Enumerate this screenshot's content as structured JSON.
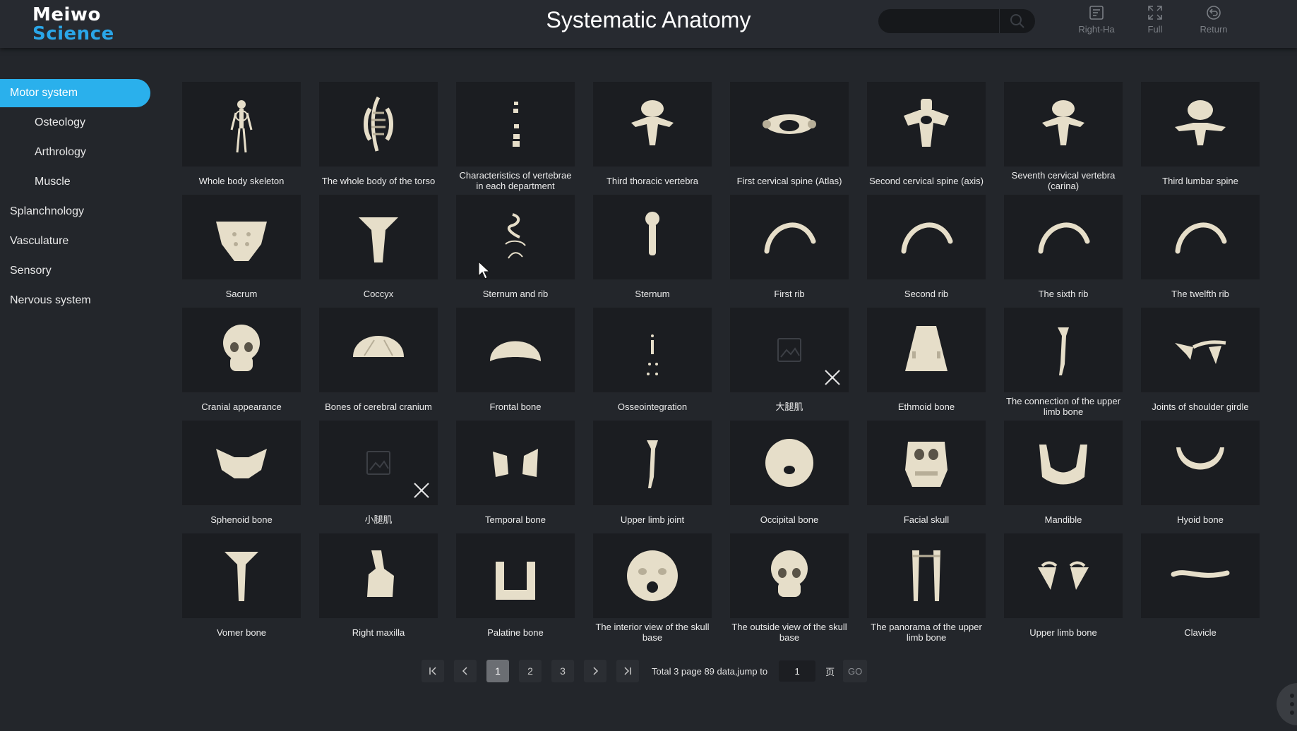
{
  "header": {
    "logo_line1": "Meiwo",
    "logo_line2": "Science",
    "title": "Systematic Anatomy",
    "search_placeholder": "",
    "tools": [
      {
        "label": "Right-Ha",
        "icon": "hand-sliders-icon"
      },
      {
        "label": "Full",
        "icon": "fullscreen-icon"
      },
      {
        "label": "Return",
        "icon": "return-icon"
      }
    ]
  },
  "sidebar": {
    "items": [
      {
        "label": "Motor system",
        "active": true,
        "level": 1
      },
      {
        "label": "Osteology",
        "active": false,
        "level": 2
      },
      {
        "label": "Arthrology",
        "active": false,
        "level": 2
      },
      {
        "label": "Muscle",
        "active": false,
        "level": 2
      },
      {
        "label": "Splanchnology",
        "active": false,
        "level": 1
      },
      {
        "label": "Vasculature",
        "active": false,
        "level": 1
      },
      {
        "label": "Sensory",
        "active": false,
        "level": 1
      },
      {
        "label": "Nervous system",
        "active": false,
        "level": 1
      }
    ]
  },
  "grid": {
    "items": [
      {
        "label": "Whole body skeleton",
        "icon": "skeleton-icon"
      },
      {
        "label": "The whole body of the torso",
        "icon": "spine-torso-icon"
      },
      {
        "label": "Characteristics of vertebrae in each department",
        "icon": "vertebrae-column-icon"
      },
      {
        "label": "Third thoracic vertebra",
        "icon": "vertebra-icon"
      },
      {
        "label": "First cervical spine (Atlas)",
        "icon": "atlas-vertebra-icon"
      },
      {
        "label": "Second cervical spine (axis)",
        "icon": "axis-vertebra-icon"
      },
      {
        "label": "Seventh cervical vertebra (carina)",
        "icon": "vertebra-icon"
      },
      {
        "label": "Third lumbar spine",
        "icon": "lumbar-vertebra-icon"
      },
      {
        "label": "Sacrum",
        "icon": "sacrum-icon"
      },
      {
        "label": "Coccyx",
        "icon": "coccyx-icon"
      },
      {
        "label": "Sternum and rib",
        "icon": "sternum-rib-icon"
      },
      {
        "label": "Sternum",
        "icon": "sternum-icon"
      },
      {
        "label": "First rib",
        "icon": "rib-icon"
      },
      {
        "label": "Second rib",
        "icon": "rib-icon"
      },
      {
        "label": "The sixth rib",
        "icon": "rib-icon"
      },
      {
        "label": "The twelfth rib",
        "icon": "rib-icon"
      },
      {
        "label": "Cranial appearance",
        "icon": "skull-icon"
      },
      {
        "label": "Bones of cerebral cranium",
        "icon": "cranium-icon"
      },
      {
        "label": "Frontal bone",
        "icon": "frontal-bone-icon"
      },
      {
        "label": "Osseointegration",
        "icon": "osseointegration-icon"
      },
      {
        "label": "大腿肌",
        "icon": "placeholder-image-icon",
        "broken": true
      },
      {
        "label": "Ethmoid bone",
        "icon": "ethmoid-bone-icon"
      },
      {
        "label": "The connection of the upper limb bone",
        "icon": "arm-bone-icon"
      },
      {
        "label": "Joints of shoulder girdle",
        "icon": "shoulder-girdle-icon"
      },
      {
        "label": "Sphenoid bone",
        "icon": "sphenoid-bone-icon"
      },
      {
        "label": "小腿肌",
        "icon": "placeholder-image-icon",
        "broken": true
      },
      {
        "label": "Temporal bone",
        "icon": "temporal-bone-icon"
      },
      {
        "label": "Upper limb joint",
        "icon": "arm-bone-icon"
      },
      {
        "label": "Occipital bone",
        "icon": "occipital-bone-icon"
      },
      {
        "label": "Facial skull",
        "icon": "facial-skull-icon"
      },
      {
        "label": "Mandible",
        "icon": "mandible-icon"
      },
      {
        "label": "Hyoid bone",
        "icon": "hyoid-bone-icon"
      },
      {
        "label": "Vomer bone",
        "icon": "vomer-bone-icon"
      },
      {
        "label": "Right maxilla",
        "icon": "maxilla-icon"
      },
      {
        "label": "Palatine bone",
        "icon": "palatine-bone-icon"
      },
      {
        "label": "The interior view of the skull base",
        "icon": "skull-base-icon"
      },
      {
        "label": "The outside view of the skull base",
        "icon": "skull-icon"
      },
      {
        "label": "The panorama of the upper limb bone",
        "icon": "arm-bones-pair-icon"
      },
      {
        "label": "Upper limb bone",
        "icon": "scapula-pair-icon"
      },
      {
        "label": "Clavicle",
        "icon": "clavicle-icon"
      }
    ]
  },
  "pagination": {
    "pages": [
      "1",
      "2",
      "3"
    ],
    "current": "1",
    "summary": "Total 3 page 89 data,jump to",
    "jump_value": "1",
    "unit": "页",
    "go_label": "GO"
  },
  "colors": {
    "accent": "#2ab0ec",
    "background": "#23262b",
    "card": "#1b1d21",
    "bone": "#e8e0cc"
  }
}
